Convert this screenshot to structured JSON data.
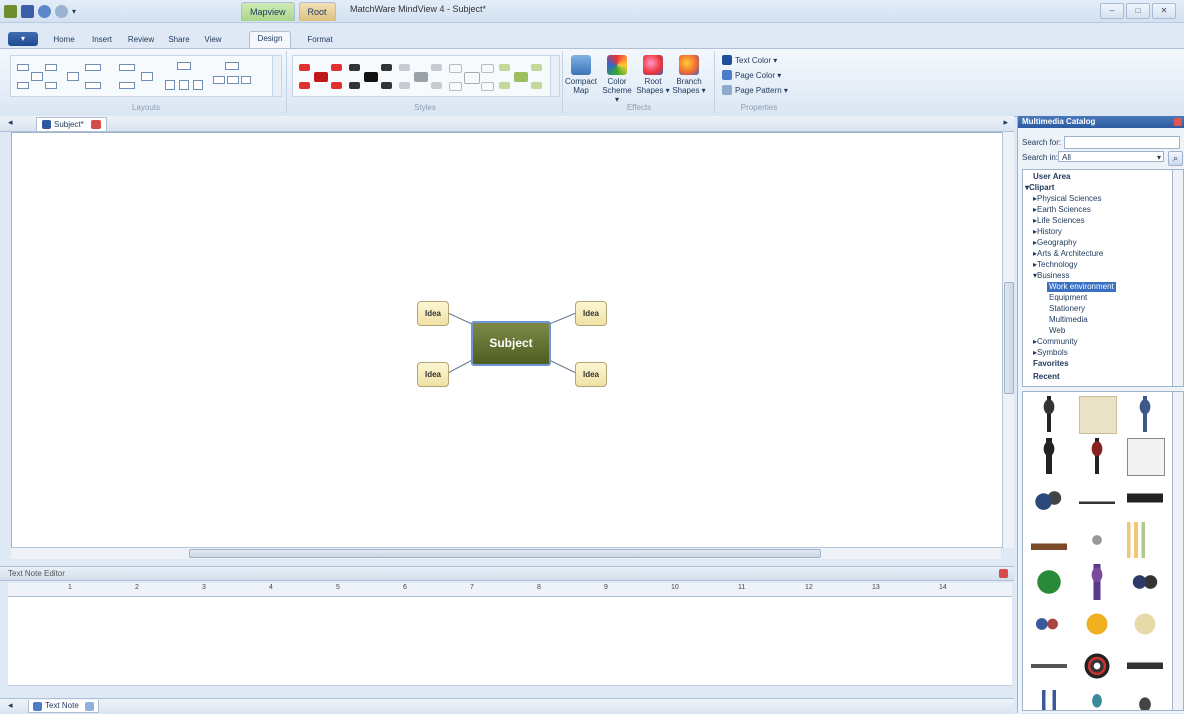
{
  "window": {
    "title": "MatchWare MindView 4 - Subject*",
    "context_tabs": [
      "Mapview",
      "Root"
    ],
    "controls": [
      "–",
      "□",
      "✕"
    ]
  },
  "ribbon_tabs": [
    "Home",
    "Insert",
    "Review",
    "Share",
    "View",
    "Design",
    "Format"
  ],
  "active_tab": "Design",
  "groups": {
    "layouts": "Layouts",
    "styles": "Styles",
    "effects": "Effects",
    "properties": "Properties"
  },
  "effects_buttons": [
    {
      "line1": "Compact",
      "line2": "Map"
    },
    {
      "line1": "Color",
      "line2": "Scheme ▾"
    },
    {
      "line1": "Root",
      "line2": "Shapes ▾"
    },
    {
      "line1": "Branch",
      "line2": "Shapes ▾"
    }
  ],
  "properties_buttons": [
    "Text Color ▾",
    "Page Color ▾",
    "Page Pattern ▾"
  ],
  "doc_tab": "Subject*",
  "map": {
    "root": "Subject",
    "ideas": [
      "Idea",
      "Idea",
      "Idea",
      "Idea"
    ]
  },
  "text_note": {
    "header": "Text Note Editor",
    "tab": "Text Note",
    "ruler_numbers": [
      "1",
      "2",
      "3",
      "4",
      "5",
      "6",
      "7",
      "8",
      "9",
      "10",
      "11",
      "12",
      "13",
      "14"
    ]
  },
  "catalog": {
    "title": "Multimedia Catalog",
    "search_for_label": "Search for:",
    "search_in_label": "Search in:",
    "search_in_value": "All",
    "tree": [
      {
        "label": "User Area",
        "level": 0,
        "bold": true
      },
      {
        "label": "▾Clipart",
        "level": 0,
        "bold": true
      },
      {
        "label": "▸Physical Sciences",
        "level": 1
      },
      {
        "label": "▸Earth Sciences",
        "level": 1
      },
      {
        "label": "▸Life Sciences",
        "level": 1
      },
      {
        "label": "▸History",
        "level": 1
      },
      {
        "label": "▸Geography",
        "level": 1
      },
      {
        "label": "▸Arts & Architecture",
        "level": 1
      },
      {
        "label": "▸Technology",
        "level": 1
      },
      {
        "label": "▾Business",
        "level": 1
      },
      {
        "label": "Work environment",
        "level": 2,
        "selected": true
      },
      {
        "label": "Equipment",
        "level": 2
      },
      {
        "label": "Stationery",
        "level": 2
      },
      {
        "label": "Multimedia",
        "level": 2
      },
      {
        "label": "Web",
        "level": 2
      },
      {
        "label": "▸Community",
        "level": 1
      },
      {
        "label": "▸Symbols",
        "level": 1
      },
      {
        "label": "Favorites",
        "level": 0,
        "bold": true
      },
      {
        "label": "Recent",
        "level": 0,
        "bold": true
      }
    ]
  },
  "colors": {
    "root_fill": "#5f6d2e",
    "idea_fill": "#f7edbe",
    "catalog_header": "#2c5aa0",
    "selection": "#3a6fc4"
  }
}
